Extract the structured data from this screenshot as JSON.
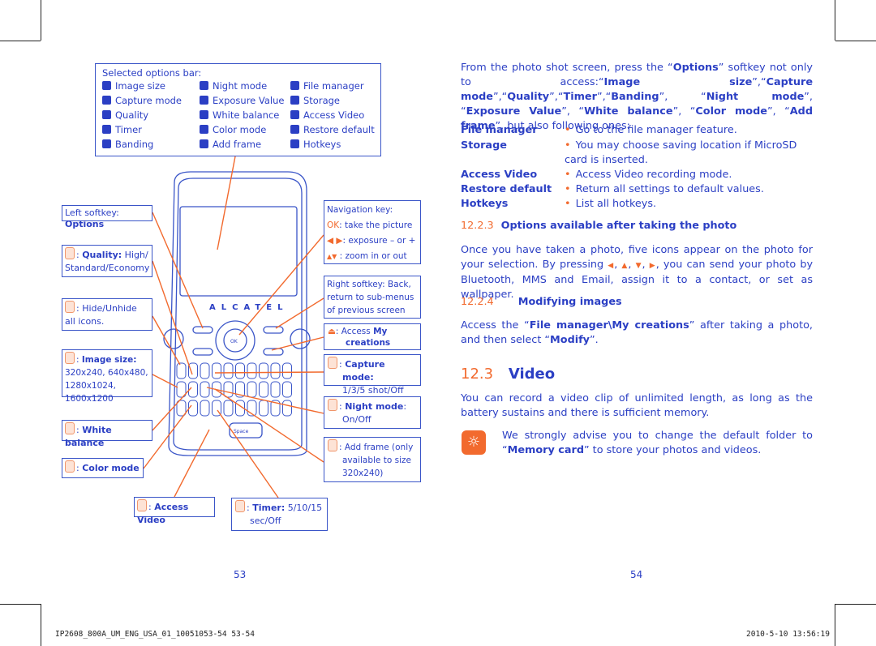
{
  "options_bar": {
    "title": "Selected options bar:",
    "col1": [
      "Image size",
      "Capture mode",
      "Quality",
      "Timer",
      "Banding"
    ],
    "col2": [
      "Night mode",
      "Exposure Value",
      "White balance",
      "Color mode",
      "Add frame"
    ],
    "col3": [
      "File manager",
      "Storage",
      "Access Video",
      "Restore default",
      "Hotkeys"
    ]
  },
  "phone": {
    "brand": "ALCATEL",
    "ok": "OK",
    "space": "Space"
  },
  "callouts": {
    "left_softkey": {
      "label": "Left softkey: ",
      "bold": "Options"
    },
    "quality": {
      "bold": "Quality:",
      "text": " High/ Standard/Economy"
    },
    "hide": {
      "text": ": Hide/Unhide all icons."
    },
    "image_size": {
      "bold": "Image size:",
      "text": "320x240, 640x480, 1280x1024, 1600x1200"
    },
    "white_balance": {
      "bold": "White balance"
    },
    "color_mode": {
      "bold": "Color mode"
    },
    "access_video": {
      "bold": "Access Video"
    },
    "timer": {
      "bold": "Timer:",
      "text": " 5/10/15 sec/Off"
    },
    "nav": {
      "title": "Navigation key:",
      "ok": "OK",
      "ok_text": ": take the picture",
      "lr_text": ": exposure – or +",
      "ud_text": ": zoom in or out"
    },
    "right_softkey": {
      "text": "Right softkey: Back, return to sub-menus of previous screen"
    },
    "access_my": {
      "text": ": Access ",
      "bold": "My creations"
    },
    "capture_mode": {
      "bold": "Capture mode:",
      "text": "1/3/5 shot/Off"
    },
    "night_mode": {
      "bold": "Night mode",
      "text": ": On/Off"
    },
    "add_frame": {
      "text": ": Add frame (only available to size 320x240)"
    }
  },
  "right": {
    "intro": [
      "From the photo shot screen, press the “",
      "Options",
      "” softkey not only to access:“",
      "Image size",
      "”,“",
      "Capture mode",
      "”,“",
      "Quality",
      "”,“",
      "Timer",
      "”,“",
      "Banding",
      "”, “",
      "Night mode",
      "”, “",
      "Exposure Value",
      "”, “",
      "White balance",
      "”, “",
      "Color mode",
      "”, “",
      "Add frame",
      "”, but also following ones:"
    ],
    "defs": [
      {
        "term": "File manager",
        "desc": "Go to the file manager feature."
      },
      {
        "term": "Storage",
        "desc": "You may choose saving location if MicroSD card is inserted."
      },
      {
        "term": "Access Video",
        "desc": "Access Video recording mode."
      },
      {
        "term": "Restore default",
        "desc": "Return all settings to default values."
      },
      {
        "term": "Hotkeys",
        "desc": "List all hotkeys."
      }
    ],
    "s1223": {
      "num": "12.2.3",
      "title": "Options available after taking the photo"
    },
    "p1223": [
      "Once you have taken a photo, five icons appear on the photo for your selection. By pressing ",
      ", ",
      ", ",
      ", ",
      ", you can send your photo by Bluetooth, MMS and Email, assign it to a contact, or set as wallpaper."
    ],
    "s1224": {
      "num": "12.2.4",
      "title": "Modifying images"
    },
    "p1224": [
      "Access the “",
      "File manager\\My creations",
      "” after taking a photo, and then select “",
      "Modify",
      "”."
    ],
    "s123": {
      "num": "12.3",
      "title": "Video"
    },
    "p123": "You can record a video clip of unlimited length, as long as the battery sustains and there is sufficient memory.",
    "tip": [
      "We strongly advise you to change the default folder to “",
      "Memory card",
      "” to store your photos and videos."
    ]
  },
  "page_left": "53",
  "page_right": "54",
  "footer": {
    "left": "IP2608_800A_UM_ENG_USA_01_10051053-54   53-54",
    "right": "2010-5-10   13:56:19"
  },
  "colors": {
    "text": "#2b3fc4",
    "accent": "#f26a2e"
  }
}
